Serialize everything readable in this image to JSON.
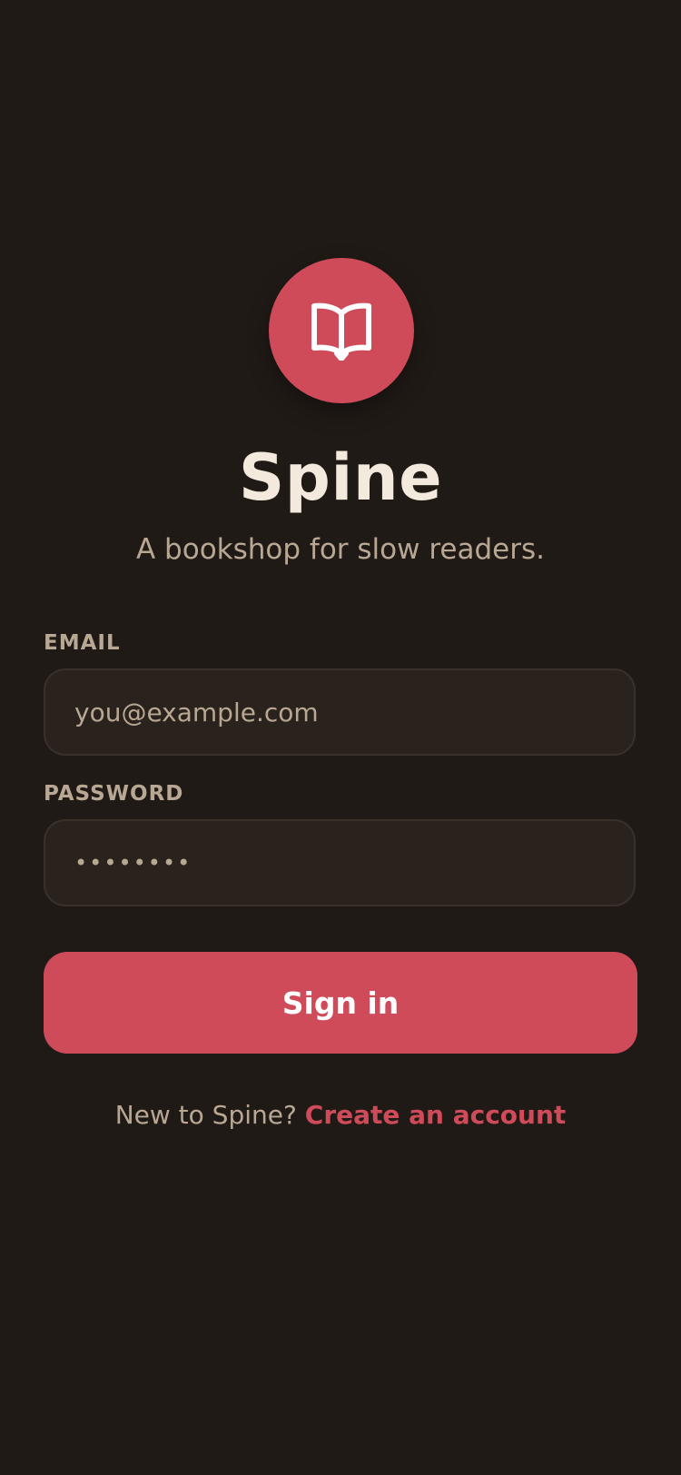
{
  "brand": {
    "title": "Spine",
    "tagline": "A bookshop for slow readers.",
    "logo_icon": "open-book-icon",
    "accent_color": "#cf4b5a",
    "background_color": "#201a16"
  },
  "form": {
    "email_label": "EMAIL",
    "email_placeholder": "you@example.com",
    "email_value": "",
    "password_label": "PASSWORD",
    "password_value": "••••••••",
    "submit_label": "Sign in"
  },
  "footer": {
    "prompt_text": "New to Spine?",
    "link_text": "Create an account"
  }
}
